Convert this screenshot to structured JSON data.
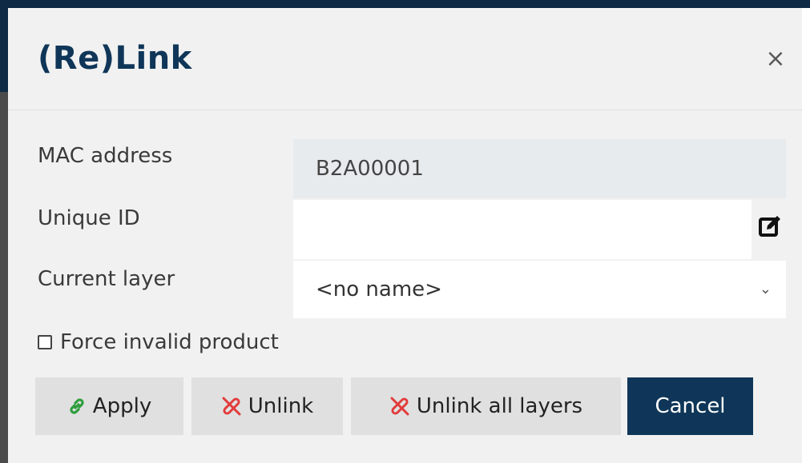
{
  "dialog": {
    "title": "(Re)Link",
    "close_icon": "×"
  },
  "form": {
    "mac_label": "MAC address",
    "mac_value": "B2A00001",
    "unique_id_label": "Unique ID",
    "unique_id_value": "",
    "current_layer_label": "Current layer",
    "current_layer_value": "<no name>",
    "chevron": "⌄",
    "force_invalid_label": "Force invalid product",
    "force_invalid_checked": false
  },
  "buttons": {
    "apply": "Apply",
    "unlink": "Unlink",
    "unlink_all": "Unlink all layers",
    "cancel": "Cancel"
  },
  "colors": {
    "title": "#0f3658",
    "cancel_bg": "#0f3658",
    "apply_icon": "#2e9e3c",
    "unlink_icon": "#e23b3b",
    "button_bg": "#e0e0e0",
    "dialog_bg": "#f1f1f1"
  },
  "icons": {
    "close": "close-icon",
    "edit": "edit-icon",
    "apply": "link-icon",
    "unlink": "unlink-icon",
    "select": "chevron-down-icon"
  }
}
